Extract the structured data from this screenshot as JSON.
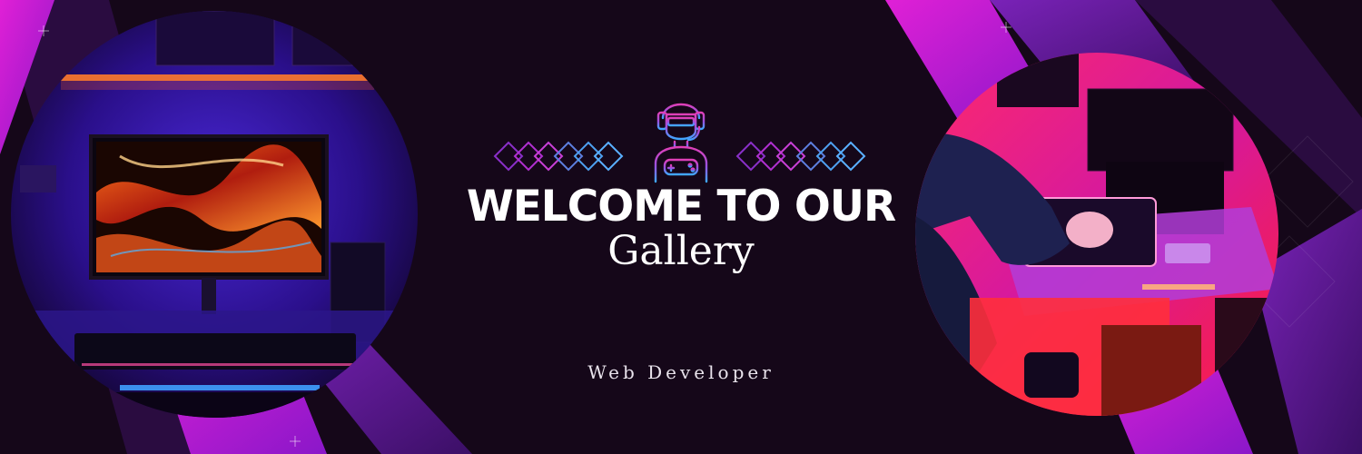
{
  "banner": {
    "heading": "WELCOME TO OUR",
    "subheading": "Gallery",
    "role": "Web Developer"
  },
  "images": {
    "left": "gaming-desk-neon-monitor-photo",
    "right": "person-at-red-lit-gaming-desk-photo",
    "avatar": "gamer-with-headset-and-controller-icon"
  },
  "colors": {
    "background": "#150719",
    "magenta": "#cc1bd0",
    "purple": "#5a1e9f",
    "deep_purple": "#2a0c40",
    "text": "#ffffff"
  }
}
